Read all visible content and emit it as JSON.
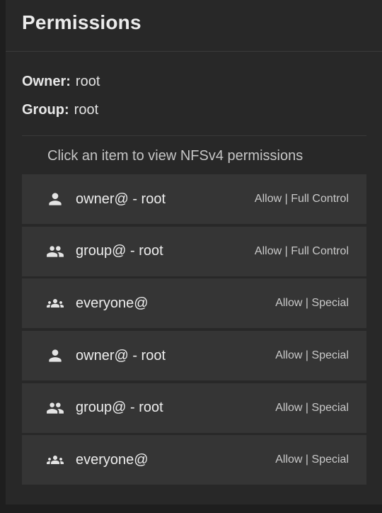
{
  "panel": {
    "title": "Permissions"
  },
  "owner": {
    "label": "Owner:",
    "value": "root"
  },
  "group": {
    "label": "Group:",
    "value": "root"
  },
  "hint": "Click an item to view NFSv4 permissions",
  "aces": [
    {
      "icon": "person-icon",
      "who": "owner@ - root",
      "perm": "Allow | Full Control"
    },
    {
      "icon": "group-icon",
      "who": "group@ - root",
      "perm": "Allow | Full Control"
    },
    {
      "icon": "everyone-icon",
      "who": "everyone@",
      "perm": "Allow | Special"
    },
    {
      "icon": "person-icon",
      "who": "owner@ - root",
      "perm": "Allow | Special"
    },
    {
      "icon": "group-icon",
      "who": "group@ - root",
      "perm": "Allow | Special"
    },
    {
      "icon": "everyone-icon",
      "who": "everyone@",
      "perm": "Allow | Special"
    }
  ]
}
